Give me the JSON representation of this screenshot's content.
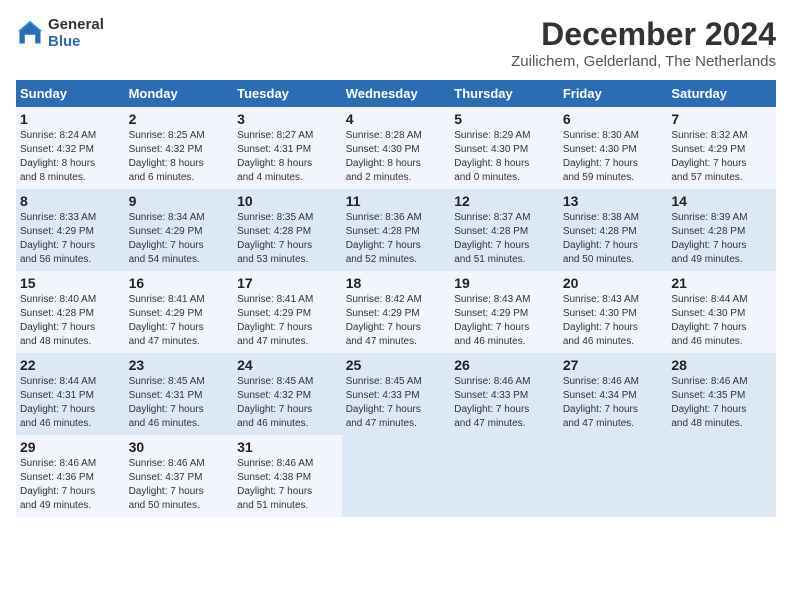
{
  "header": {
    "logo_line1": "General",
    "logo_line2": "Blue",
    "title": "December 2024",
    "subtitle": "Zuilichem, Gelderland, The Netherlands"
  },
  "calendar": {
    "days_of_week": [
      "Sunday",
      "Monday",
      "Tuesday",
      "Wednesday",
      "Thursday",
      "Friday",
      "Saturday"
    ],
    "weeks": [
      [
        {
          "day": "1",
          "info": "Sunrise: 8:24 AM\nSunset: 4:32 PM\nDaylight: 8 hours\nand 8 minutes."
        },
        {
          "day": "2",
          "info": "Sunrise: 8:25 AM\nSunset: 4:32 PM\nDaylight: 8 hours\nand 6 minutes."
        },
        {
          "day": "3",
          "info": "Sunrise: 8:27 AM\nSunset: 4:31 PM\nDaylight: 8 hours\nand 4 minutes."
        },
        {
          "day": "4",
          "info": "Sunrise: 8:28 AM\nSunset: 4:30 PM\nDaylight: 8 hours\nand 2 minutes."
        },
        {
          "day": "5",
          "info": "Sunrise: 8:29 AM\nSunset: 4:30 PM\nDaylight: 8 hours\nand 0 minutes."
        },
        {
          "day": "6",
          "info": "Sunrise: 8:30 AM\nSunset: 4:30 PM\nDaylight: 7 hours\nand 59 minutes."
        },
        {
          "day": "7",
          "info": "Sunrise: 8:32 AM\nSunset: 4:29 PM\nDaylight: 7 hours\nand 57 minutes."
        }
      ],
      [
        {
          "day": "8",
          "info": "Sunrise: 8:33 AM\nSunset: 4:29 PM\nDaylight: 7 hours\nand 56 minutes."
        },
        {
          "day": "9",
          "info": "Sunrise: 8:34 AM\nSunset: 4:29 PM\nDaylight: 7 hours\nand 54 minutes."
        },
        {
          "day": "10",
          "info": "Sunrise: 8:35 AM\nSunset: 4:28 PM\nDaylight: 7 hours\nand 53 minutes."
        },
        {
          "day": "11",
          "info": "Sunrise: 8:36 AM\nSunset: 4:28 PM\nDaylight: 7 hours\nand 52 minutes."
        },
        {
          "day": "12",
          "info": "Sunrise: 8:37 AM\nSunset: 4:28 PM\nDaylight: 7 hours\nand 51 minutes."
        },
        {
          "day": "13",
          "info": "Sunrise: 8:38 AM\nSunset: 4:28 PM\nDaylight: 7 hours\nand 50 minutes."
        },
        {
          "day": "14",
          "info": "Sunrise: 8:39 AM\nSunset: 4:28 PM\nDaylight: 7 hours\nand 49 minutes."
        }
      ],
      [
        {
          "day": "15",
          "info": "Sunrise: 8:40 AM\nSunset: 4:28 PM\nDaylight: 7 hours\nand 48 minutes."
        },
        {
          "day": "16",
          "info": "Sunrise: 8:41 AM\nSunset: 4:29 PM\nDaylight: 7 hours\nand 47 minutes."
        },
        {
          "day": "17",
          "info": "Sunrise: 8:41 AM\nSunset: 4:29 PM\nDaylight: 7 hours\nand 47 minutes."
        },
        {
          "day": "18",
          "info": "Sunrise: 8:42 AM\nSunset: 4:29 PM\nDaylight: 7 hours\nand 47 minutes."
        },
        {
          "day": "19",
          "info": "Sunrise: 8:43 AM\nSunset: 4:29 PM\nDaylight: 7 hours\nand 46 minutes."
        },
        {
          "day": "20",
          "info": "Sunrise: 8:43 AM\nSunset: 4:30 PM\nDaylight: 7 hours\nand 46 minutes."
        },
        {
          "day": "21",
          "info": "Sunrise: 8:44 AM\nSunset: 4:30 PM\nDaylight: 7 hours\nand 46 minutes."
        }
      ],
      [
        {
          "day": "22",
          "info": "Sunrise: 8:44 AM\nSunset: 4:31 PM\nDaylight: 7 hours\nand 46 minutes."
        },
        {
          "day": "23",
          "info": "Sunrise: 8:45 AM\nSunset: 4:31 PM\nDaylight: 7 hours\nand 46 minutes."
        },
        {
          "day": "24",
          "info": "Sunrise: 8:45 AM\nSunset: 4:32 PM\nDaylight: 7 hours\nand 46 minutes."
        },
        {
          "day": "25",
          "info": "Sunrise: 8:45 AM\nSunset: 4:33 PM\nDaylight: 7 hours\nand 47 minutes."
        },
        {
          "day": "26",
          "info": "Sunrise: 8:46 AM\nSunset: 4:33 PM\nDaylight: 7 hours\nand 47 minutes."
        },
        {
          "day": "27",
          "info": "Sunrise: 8:46 AM\nSunset: 4:34 PM\nDaylight: 7 hours\nand 47 minutes."
        },
        {
          "day": "28",
          "info": "Sunrise: 8:46 AM\nSunset: 4:35 PM\nDaylight: 7 hours\nand 48 minutes."
        }
      ],
      [
        {
          "day": "29",
          "info": "Sunrise: 8:46 AM\nSunset: 4:36 PM\nDaylight: 7 hours\nand 49 minutes."
        },
        {
          "day": "30",
          "info": "Sunrise: 8:46 AM\nSunset: 4:37 PM\nDaylight: 7 hours\nand 50 minutes."
        },
        {
          "day": "31",
          "info": "Sunrise: 8:46 AM\nSunset: 4:38 PM\nDaylight: 7 hours\nand 51 minutes."
        },
        null,
        null,
        null,
        null
      ]
    ]
  }
}
